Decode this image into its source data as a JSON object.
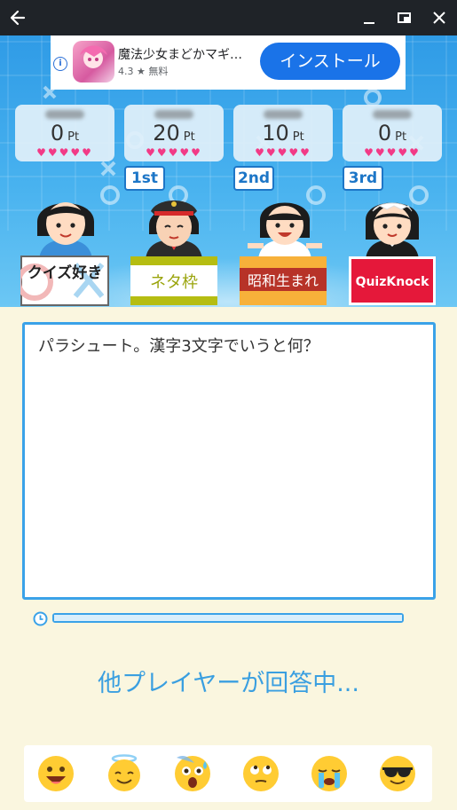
{
  "ad": {
    "title": "魔法少女まどかマギ…",
    "rating": "4.3 ★ 無料",
    "install_label": "インストール"
  },
  "players": [
    {
      "points": "0",
      "unit": "Pt",
      "hearts": "♥♥♥♥♥",
      "category": "クイズ好き"
    },
    {
      "points": "20",
      "unit": "Pt",
      "hearts": "♥♥♥♥♥",
      "category": "ネタ枠",
      "rank": "1st"
    },
    {
      "points": "10",
      "unit": "Pt",
      "hearts": "♥♥♥♥♥",
      "category": "昭和生まれ",
      "rank": "2nd"
    },
    {
      "points": "0",
      "unit": "Pt",
      "hearts": "♥♥♥♥♥",
      "category": "QuizKnock",
      "rank": "3rd"
    }
  ],
  "question": {
    "text": "パラシュート。漢字3文字でいうと何？"
  },
  "timer": {
    "remaining_fraction": 1.0
  },
  "status": {
    "text": "他プレイヤーが回答中..."
  },
  "icons": [
    "back-arrow-icon",
    "minimize-icon",
    "restore-icon",
    "close-icon",
    "ad-info-icon",
    "clock-icon"
  ],
  "colors": {
    "accent": "#3aa2e8",
    "heart": "#f23a86",
    "install": "#1a73e8"
  }
}
